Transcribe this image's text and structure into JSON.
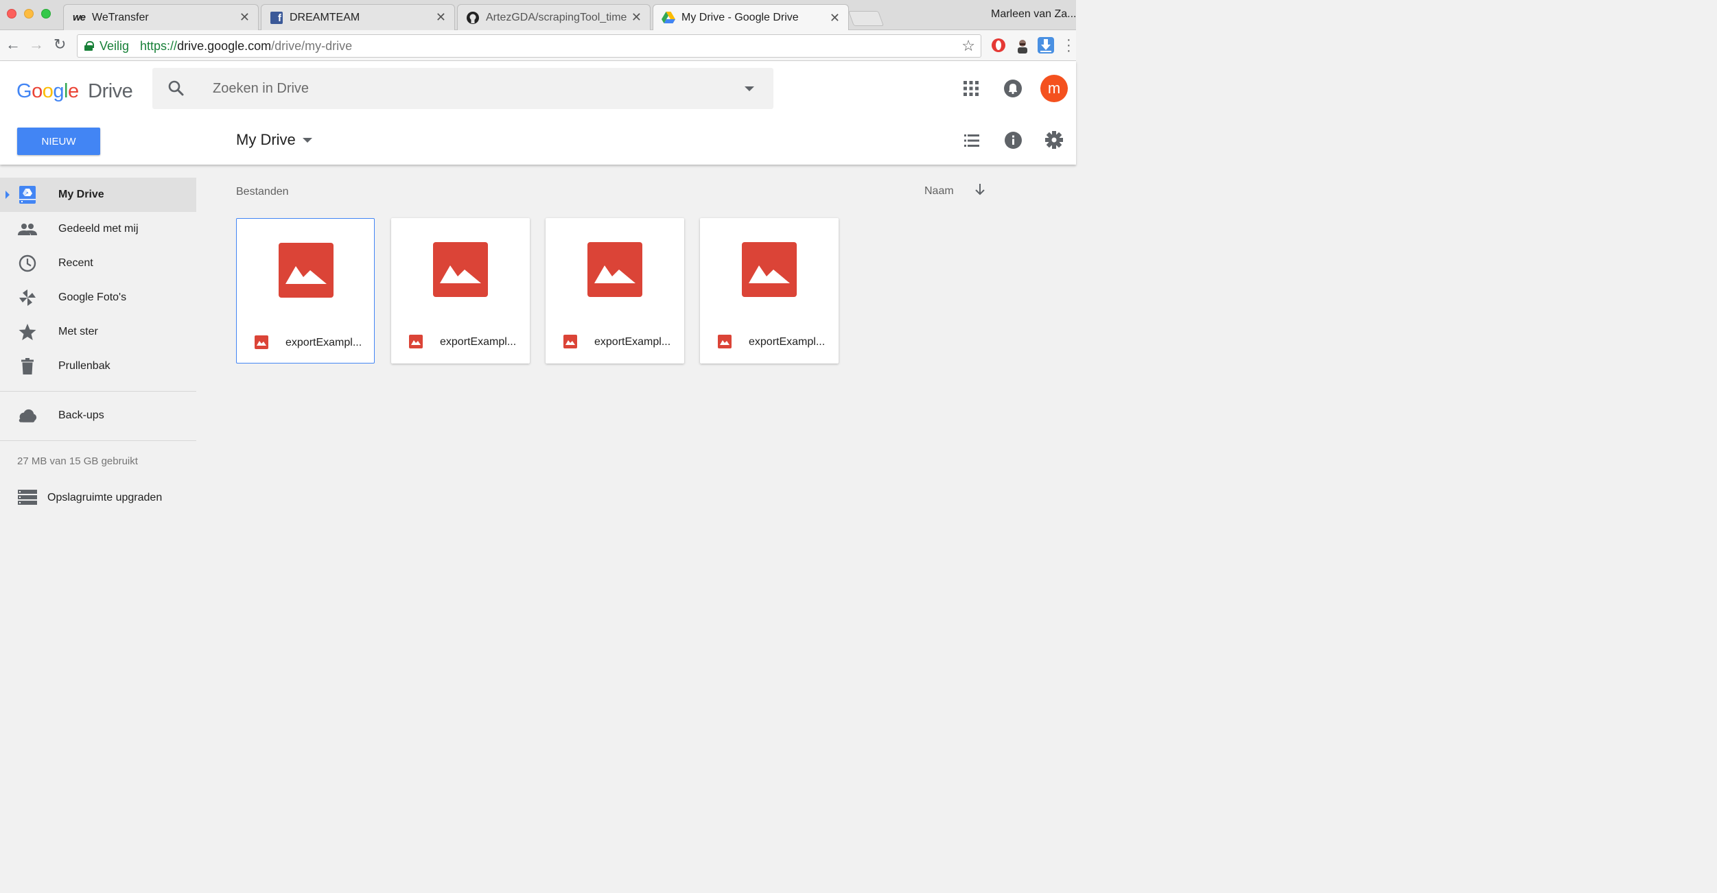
{
  "browser": {
    "tabs": [
      {
        "title": "WeTransfer",
        "icon": "wetransfer-icon"
      },
      {
        "title": "DREAMTEAM",
        "icon": "facebook-icon"
      },
      {
        "title": "ArtezGDA/scrapingTool_timela",
        "icon": "github-icon"
      },
      {
        "title": "My Drive - Google Drive",
        "icon": "google-drive-icon",
        "active": true
      }
    ],
    "user": "Marleen van Za...",
    "url": {
      "secure_label": "Veilig",
      "scheme": "https://",
      "host": "drive.google.com",
      "path": "/drive/my-drive"
    }
  },
  "app": {
    "logo_google": "Google",
    "logo_drive": "Drive",
    "search_placeholder": "Zoeken in Drive",
    "avatar_letter": "m",
    "new_button": "NIEUW",
    "location_title": "My Drive",
    "accent": "#4285f4",
    "avatar_color": "#f4511e",
    "file_color": "#db4437"
  },
  "sidebar": {
    "items": [
      {
        "label": "My Drive",
        "icon": "my-drive-icon",
        "active": true
      },
      {
        "label": "Gedeeld met mij",
        "icon": "shared-people-icon"
      },
      {
        "label": "Recent",
        "icon": "clock-icon"
      },
      {
        "label": "Google Foto's",
        "icon": "photos-pinwheel-icon"
      },
      {
        "label": "Met ster",
        "icon": "star-icon"
      },
      {
        "label": "Prullenbak",
        "icon": "trash-icon"
      }
    ],
    "backups": "Back-ups",
    "quota": "27 MB van 15 GB gebruikt",
    "upgrade": "Opslagruimte upgraden"
  },
  "main": {
    "section_title": "Bestanden",
    "sort_label": "Naam",
    "files": [
      {
        "name": "exportExampl...",
        "selected": true
      },
      {
        "name": "exportExampl..."
      },
      {
        "name": "exportExampl..."
      },
      {
        "name": "exportExampl..."
      }
    ]
  }
}
